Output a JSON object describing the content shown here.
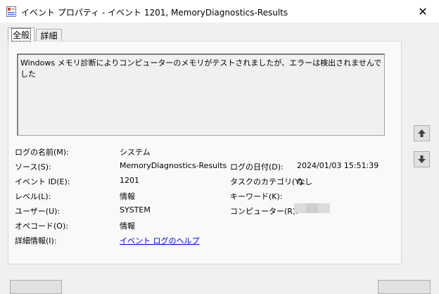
{
  "window": {
    "title": "イベント プロパティ - イベント 1201, MemoryDiagnostics-Results",
    "close_glyph": "✕"
  },
  "tabs": [
    {
      "label": "全般",
      "active": true
    },
    {
      "label": "詳細",
      "active": false
    }
  ],
  "description": "Windows メモリ診断によりコンピューターのメモリがテストされましたが、エラーは検出されませんでした",
  "fields": {
    "log_name": {
      "label": "ログの名前(M):",
      "value": "システム"
    },
    "source": {
      "label": "ソース(S):",
      "value": "MemoryDiagnostics-Results"
    },
    "logged": {
      "label": "ログの日付(D):",
      "value": "2024/01/03 15:51:39"
    },
    "event_id": {
      "label": "イベント ID(E):",
      "value": "1201"
    },
    "task_category": {
      "label": "タスクのカテゴリ(Y):",
      "value": "なし"
    },
    "level": {
      "label": "レベル(L):",
      "value": "情報"
    },
    "keywords": {
      "label": "キーワード(K):",
      "value": ""
    },
    "user": {
      "label": "ユーザー(U):",
      "value": "SYSTEM"
    },
    "computer": {
      "label": "コンピューター(R):",
      "value": ""
    },
    "opcode": {
      "label": "オペコード(O):",
      "value": "情報"
    },
    "more_info": {
      "label": "詳細情報(I):",
      "value": "イベント ログのヘルプ"
    }
  },
  "icons": {
    "up": "arrow-up-icon",
    "down": "arrow-down-icon"
  }
}
